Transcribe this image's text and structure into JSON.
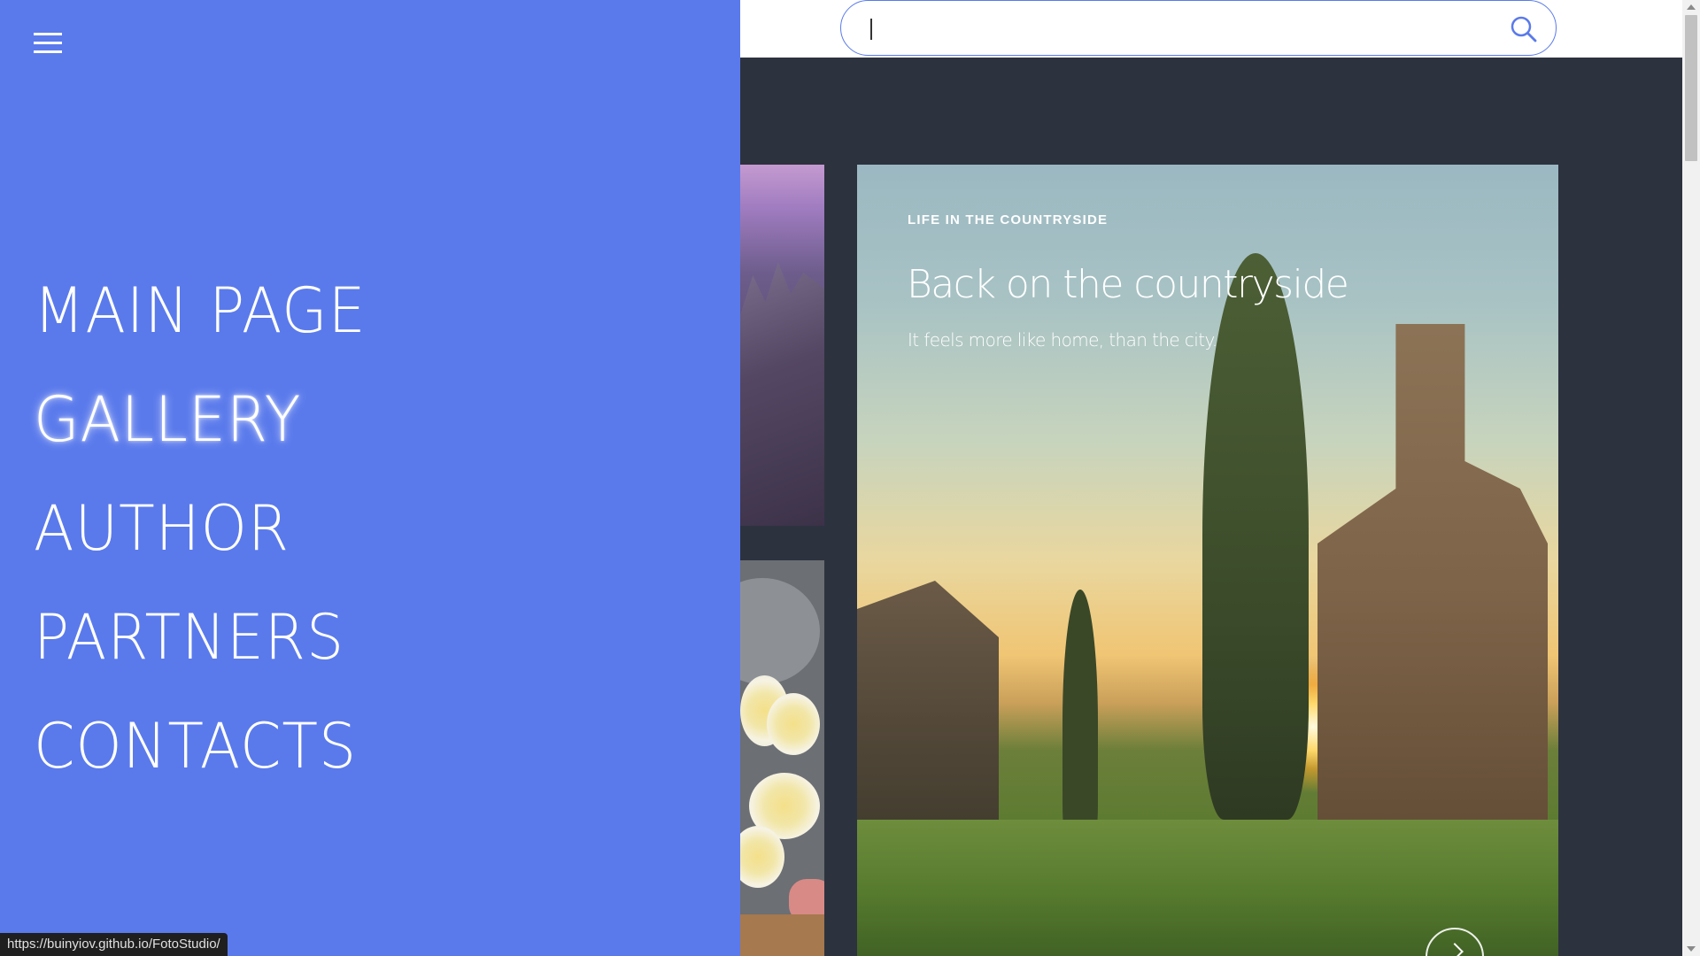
{
  "search": {
    "value": "",
    "placeholder": ""
  },
  "menu": {
    "items": [
      {
        "label": "MAIN PAGE"
      },
      {
        "label": "GALLERY"
      },
      {
        "label": "AUTHOR"
      },
      {
        "label": "PARTNERS"
      },
      {
        "label": "CONTACTS"
      }
    ],
    "hovered_item": "GALLERY",
    "colors": {
      "sidebar_bg": "#5a7aec",
      "text": "#ffffff"
    }
  },
  "hero_card": {
    "kicker": "LIFE IN THE COUNTRYSIDE",
    "title": "Back on the countryside",
    "subtitle": "It feels more like home, than the city."
  },
  "status_bar": {
    "url": "https://buinyiov.github.io/FotoStudio/"
  },
  "colors": {
    "page_bg": "#2d323f",
    "search_border": "#5a7aea"
  }
}
